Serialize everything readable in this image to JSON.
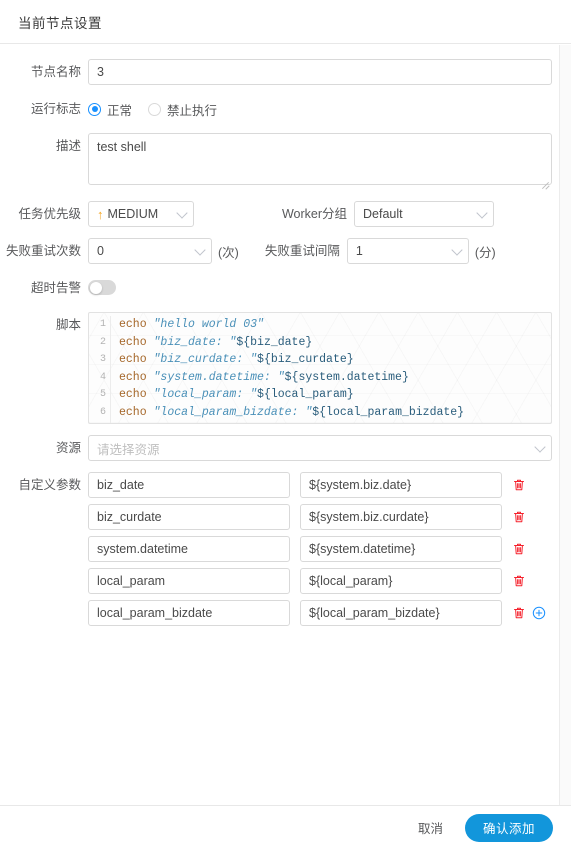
{
  "header": {
    "title": "当前节点设置"
  },
  "form": {
    "node_name": {
      "label": "节点名称",
      "value": "3"
    },
    "run_flag": {
      "label": "运行标志",
      "options": [
        {
          "label": "正常",
          "selected": true
        },
        {
          "label": "禁止执行",
          "selected": false
        }
      ]
    },
    "description": {
      "label": "描述",
      "value": "test shell"
    },
    "priority": {
      "label": "任务优先级",
      "value": "MEDIUM",
      "arrow": "↑"
    },
    "worker_group": {
      "label": "Worker分组",
      "value": "Default"
    },
    "retry_times": {
      "label": "失败重试次数",
      "value": "0",
      "suffix": "(次)"
    },
    "retry_interval": {
      "label": "失败重试间隔",
      "value": "1",
      "suffix": "(分)"
    },
    "timeout_alarm": {
      "label": "超时告警",
      "on": false
    },
    "script": {
      "label": "脚本",
      "lines": [
        {
          "no": "1",
          "kw": "echo",
          "str": "\"hello world 03\"",
          "var": ""
        },
        {
          "no": "2",
          "kw": "echo",
          "str": "\"biz_date: \"",
          "var": "${biz_date}"
        },
        {
          "no": "3",
          "kw": "echo",
          "str": "\"biz_curdate: \"",
          "var": "${biz_curdate}"
        },
        {
          "no": "4",
          "kw": "echo",
          "str": "\"system.datetime: \"",
          "var": "${system.datetime}"
        },
        {
          "no": "5",
          "kw": "echo",
          "str": "\"local_param: \"",
          "var": "${local_param}"
        },
        {
          "no": "6",
          "kw": "echo",
          "str": "\"local_param_bizdate: \"",
          "var": "${local_param_bizdate}"
        }
      ]
    },
    "resource": {
      "label": "资源",
      "placeholder": "请选择资源",
      "value": ""
    },
    "custom_params": {
      "label": "自定义参数",
      "rows": [
        {
          "key": "biz_date",
          "value": "${system.biz.date}"
        },
        {
          "key": "biz_curdate",
          "value": "${system.biz.curdate}"
        },
        {
          "key": "system.datetime",
          "value": "${system.datetime}"
        },
        {
          "key": "local_param",
          "value": "${local_param}"
        },
        {
          "key": "local_param_bizdate",
          "value": "${local_param_bizdate}"
        }
      ]
    }
  },
  "footer": {
    "cancel_label": "取消",
    "confirm_label": "确认添加"
  },
  "colors": {
    "accent": "#1890ff",
    "primary_button": "#1296db",
    "danger": "#f5222d",
    "priority_arrow": "#f5a623"
  }
}
